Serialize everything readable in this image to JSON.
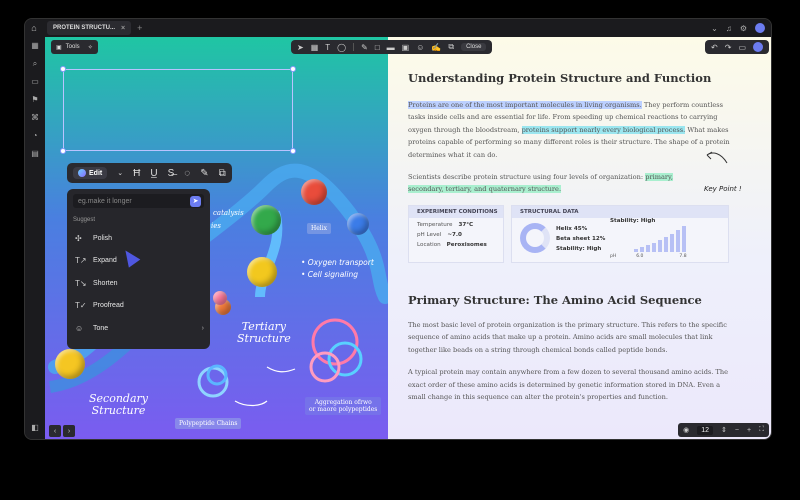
{
  "tab": {
    "title": "PROTEIN STRUCTU...",
    "close": "×"
  },
  "titlebar": {
    "new_tab": "+"
  },
  "toolbar": {
    "tools_label": "Tools",
    "close_label": "Close"
  },
  "edit_bar": {
    "edit_label": "Edit"
  },
  "ai_menu": {
    "placeholder": "eg.make it longer",
    "suggest_label": "Suggest",
    "items": [
      {
        "label": "Polish",
        "icon": "sparkle-icon"
      },
      {
        "label": "Expand",
        "icon": "expand-text-icon"
      },
      {
        "label": "Shorten",
        "icon": "shorten-text-icon"
      },
      {
        "label": "Proofread",
        "icon": "proofread-icon"
      },
      {
        "label": "Tone",
        "icon": "tone-icon"
      }
    ]
  },
  "illustration": {
    "helix_tag": "Helix",
    "bullets": [
      "• Oxygen transport",
      "• Cell signaling"
    ],
    "tertiary": "Tertiary\nStructure",
    "secondary": "Secondary\nStructure",
    "polypeptide_tag": "Polypeptide Chains",
    "aggregation_tag": "Aggregation ofrwo\nor maore polypeptides",
    "partial_top": "catalysis",
    "partial_mid": "ies"
  },
  "doc": {
    "title": "Understanding Protein Structure and Function",
    "p1_hl1": "Proteins are one of the most important molecules in living organisms.",
    "p1_t1": " They perform countless tasks inside cells and are essential for life. From speeding up chemical reactions to carrying oxygen through the bloodstream, ",
    "p1_hl2": "proteins support nearly every biological process.",
    "p1_t2": " What makes proteins capable of performing so many different roles is their structure. The shape of a protein determines what it can do.",
    "p2_t1": "Scientists describe protein structure using four levels of organization: ",
    "p2_hl": "primary, secondary, tertiary, and quaternary structure.",
    "keypoint": "Key Point !",
    "exp_header": "EXPERIMENT CONDITIONS",
    "exp_rows": [
      {
        "k": "Temperature",
        "v": "37°C"
      },
      {
        "k": "pH Level",
        "v": "~7.0"
      },
      {
        "k": "Location",
        "v": "Peroxisomes"
      }
    ],
    "struct_header": "STRUCTURAL DATA",
    "struct_rows": [
      "Helix 45%",
      "Beta sheet 12%",
      "Stability: High"
    ],
    "stability_label": "Stability: High",
    "axis": [
      "pH",
      "6.0",
      "7.8"
    ],
    "h2": "Primary Structure: The Amino Acid Sequence",
    "p3": "The most basic level of protein organization is the primary structure. This refers to the specific sequence of amino acids that make up a protein. Amino acids are small molecules that link together like beads on a string through chemical bonds called peptide bonds.",
    "p4": "A typical protein may contain anywhere from a few dozen to several thousand amino acids. The exact order of these amino acids is determined by genetic information stored in DNA. Even a small change in this sequence can alter the protein's properties and function."
  },
  "zoom": {
    "value": "12"
  },
  "colors": {
    "accent": "#6c7cf0",
    "highlight_blue": "#bcd0ff",
    "highlight_cyan": "#9be6ef",
    "highlight_green": "#a9efcf"
  }
}
